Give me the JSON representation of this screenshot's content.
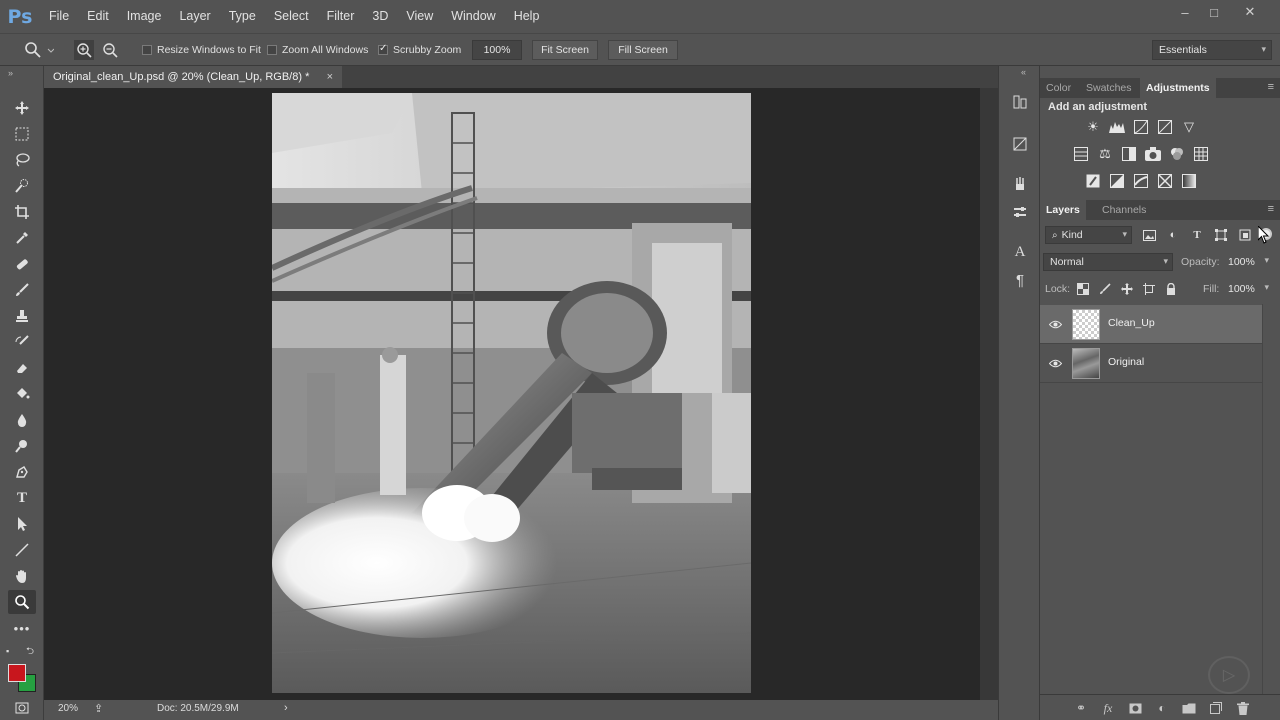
{
  "app": {
    "logo": "Ps"
  },
  "menu": [
    "File",
    "Edit",
    "Image",
    "Layer",
    "Type",
    "Select",
    "Filter",
    "3D",
    "View",
    "Window",
    "Help"
  ],
  "window_controls": {
    "minimize": "–",
    "maximize": "□",
    "close": "✕"
  },
  "options_bar": {
    "resize_windows": {
      "label": "Resize Windows to Fit",
      "checked": false
    },
    "zoom_all": {
      "label": "Zoom All Windows",
      "checked": false
    },
    "scrubby_zoom": {
      "label": "Scrubby Zoom",
      "checked": true
    },
    "zoom_value": "100%",
    "fit_screen": "Fit Screen",
    "fill_screen": "Fill Screen",
    "workspace": "Essentials"
  },
  "document": {
    "tab_title": "Original_clean_Up.psd @ 20% (Clean_Up, RGB/8) *",
    "close_glyph": "×",
    "status_zoom": "20%",
    "status_doc": "Doc: 20.5M/29.9M"
  },
  "adjustments_panel": {
    "tabs": [
      "Color",
      "Swatches",
      "Adjustments"
    ],
    "active_tab": "Adjustments",
    "title": "Add an adjustment"
  },
  "layers_panel": {
    "tabs": [
      "Layers",
      "Channels"
    ],
    "active_tab": "Layers",
    "kind_filter": "Kind",
    "blend_mode": "Normal",
    "opacity_label": "Opacity:",
    "opacity_value": "100%",
    "lock_label": "Lock:",
    "fill_label": "Fill:",
    "fill_value": "100%",
    "layers": [
      {
        "name": "Clean_Up",
        "visible": true,
        "selected": true
      },
      {
        "name": "Original",
        "visible": true,
        "selected": false
      }
    ]
  },
  "colors": {
    "foreground": "#c8161d",
    "background": "#26a041",
    "accent": "#6fa9e3"
  }
}
